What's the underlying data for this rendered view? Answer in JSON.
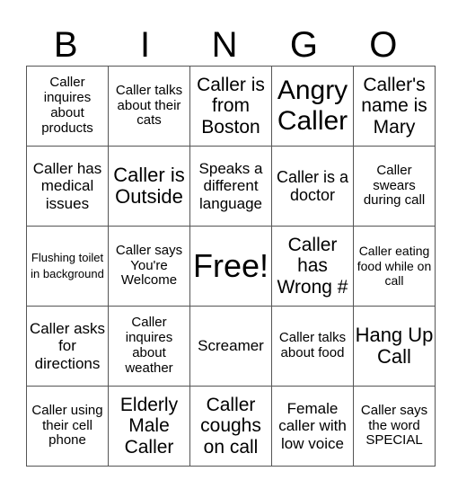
{
  "header": [
    "B",
    "I",
    "N",
    "G",
    "O"
  ],
  "rows": [
    [
      "Caller inquires about products",
      "Caller talks about their cats",
      "Caller is from Boston",
      "Angry Caller",
      "Caller's name is Mary"
    ],
    [
      "Caller has medical issues",
      "Caller is Outside",
      "Speaks a different language",
      "Caller is a doctor",
      "Caller swears during call"
    ],
    [
      "Flushing toilet in background",
      "Caller says You're Welcome",
      "Free!",
      "Caller has Wrong #",
      "Caller eating food while on call"
    ],
    [
      "Caller asks for directions",
      "Caller inquires about weather",
      "Screamer",
      "Caller talks about food",
      "Hang Up Call"
    ],
    [
      "Caller using their cell phone",
      "Elderly Male Caller",
      "Caller coughs on call",
      "Female caller with low voice",
      "Caller says the word SPECIAL"
    ]
  ]
}
